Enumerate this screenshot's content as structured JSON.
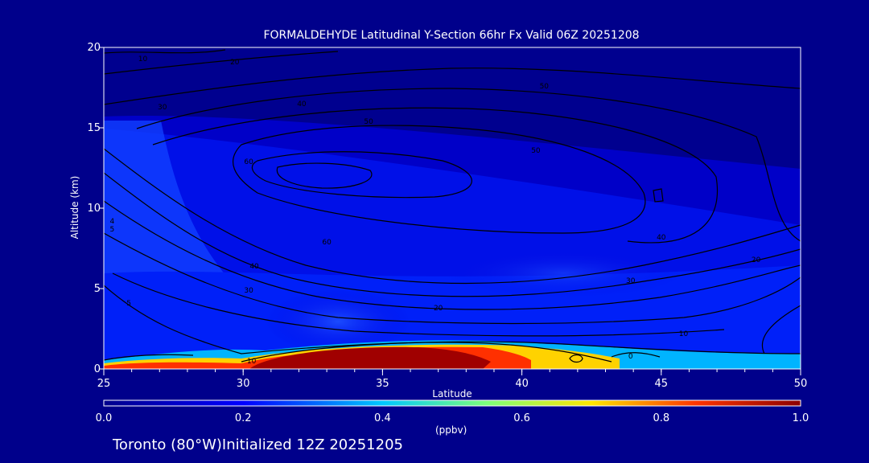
{
  "chart_data": {
    "type": "heatmap",
    "title": "FORMALDEHYDE Latitudinal Y-Section 66hr  Fx Valid 06Z 20251208",
    "xlabel": "Latitude",
    "ylabel": "Altitude (km)",
    "xlim": [
      25,
      50
    ],
    "ylim": [
      0,
      20
    ],
    "x_ticks": [
      "25",
      "30",
      "35",
      "40",
      "45",
      "50"
    ],
    "y_ticks": [
      "0",
      "5",
      "10",
      "15",
      "20"
    ],
    "colorbar": {
      "label": "(ppbv)",
      "range": [
        0.0,
        1.0
      ],
      "ticks": [
        "0.0",
        "0.2",
        "0.4",
        "0.6",
        "0.8",
        "1.0"
      ]
    },
    "contour_labels": [
      {
        "text": "10",
        "x": 26.4,
        "y": 19.3
      },
      {
        "text": "20",
        "x": 29.7,
        "y": 19.1
      },
      {
        "text": "30",
        "x": 27.1,
        "y": 16.3
      },
      {
        "text": "40",
        "x": 32.1,
        "y": 16.5
      },
      {
        "text": "50",
        "x": 34.5,
        "y": 15.4
      },
      {
        "text": "60",
        "x": 30.2,
        "y": 12.9
      },
      {
        "text": "50",
        "x": 40.8,
        "y": 17.6
      },
      {
        "text": "50",
        "x": 40.5,
        "y": 13.6
      },
      {
        "text": "60",
        "x": 33.0,
        "y": 7.9
      },
      {
        "text": "40",
        "x": 30.4,
        "y": 6.4
      },
      {
        "text": "30",
        "x": 30.2,
        "y": 4.9
      },
      {
        "text": "20",
        "x": 37.0,
        "y": 3.8
      },
      {
        "text": "30",
        "x": 43.9,
        "y": 5.5
      },
      {
        "text": "40",
        "x": 45.0,
        "y": 8.2
      },
      {
        "text": "20",
        "x": 48.4,
        "y": 6.8
      },
      {
        "text": "10",
        "x": 45.8,
        "y": 2.2
      },
      {
        "text": "10",
        "x": 30.3,
        "y": 0.5
      },
      {
        "text": "0",
        "x": 43.9,
        "y": 0.8
      },
      {
        "text": "4",
        "x": 25.3,
        "y": 9.2
      },
      {
        "text": "5",
        "x": 25.3,
        "y": 8.7
      },
      {
        "text": "5",
        "x": 25.9,
        "y": 4.1
      }
    ]
  },
  "footer": "Toronto (80°W)Initialized 12Z 20251205"
}
